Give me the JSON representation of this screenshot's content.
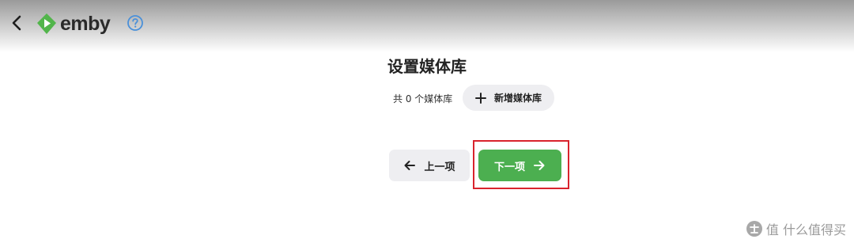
{
  "header": {
    "back_icon": "chevron-left-icon",
    "logo_text": "emby",
    "logo_color": "#52b54b",
    "help_icon": "help-circle-icon",
    "help_color": "#4a90d9"
  },
  "main": {
    "title": "设置媒体库",
    "library_count_text": "共 0 个媒体库",
    "add_library_label": "新增媒体库",
    "add_icon": "plus-icon"
  },
  "navigation": {
    "prev_label": "上一项",
    "next_label": "下一项",
    "prev_icon": "arrow-left-icon",
    "next_icon": "arrow-right-icon",
    "next_color": "#4caf50",
    "highlight_color": "#d9232d"
  },
  "watermark": {
    "text": "值 什么值得买"
  }
}
